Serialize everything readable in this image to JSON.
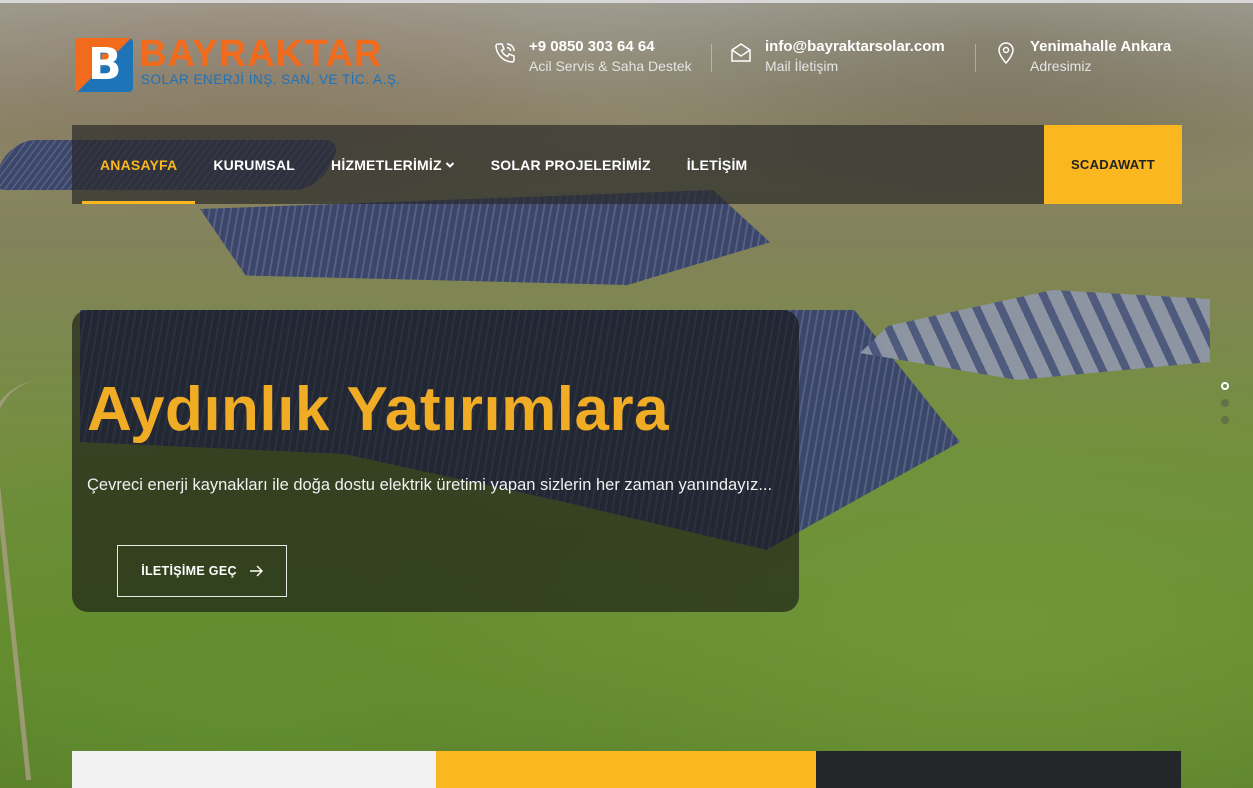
{
  "brand": {
    "name": "BAYRAKTAR",
    "subtitle": "SOLAR ENERJİ İNŞ. SAN. VE TİC. A.Ş.",
    "mark": "B",
    "colors": {
      "orange": "#f26a1b",
      "blue": "#1f73b7",
      "accent": "#fbb71f"
    }
  },
  "contacts": [
    {
      "icon": "phone-icon",
      "title": "+9 0850 303 64 64",
      "subtitle": "Acil Servis & Saha Destek"
    },
    {
      "icon": "mail-icon",
      "title": "info@bayraktarsolar.com",
      "subtitle": "Mail İletişim"
    },
    {
      "icon": "location-pin-icon",
      "title": "Yenimahalle Ankara",
      "subtitle": "Adresimiz"
    }
  ],
  "nav": {
    "items": [
      {
        "label": "ANASAYFA",
        "active": true
      },
      {
        "label": "KURUMSAL",
        "active": false
      },
      {
        "label": "HİZMETLERİMİZ",
        "active": false,
        "has_dropdown": true
      },
      {
        "label": "SOLAR PROJELERİMİZ",
        "active": false
      },
      {
        "label": "İLETİŞİM",
        "active": false
      }
    ],
    "cta_label": "SCADAWATT"
  },
  "hero": {
    "title": "Aydınlık Yatırımlara",
    "text": "Çevreci enerji kaynakları ile doğa dostu elektrik üretimi yapan sizlerin her zaman yanındayız...",
    "button_label": "İLETİŞİME GEÇ",
    "button_icon": "arrow-right-icon"
  },
  "slider": {
    "total": 3,
    "active": 1
  }
}
